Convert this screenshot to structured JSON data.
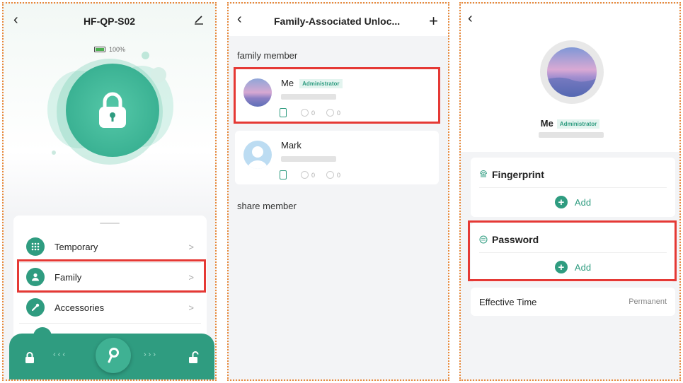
{
  "device": {
    "title": "HF-QP-S02",
    "battery_label": "100%",
    "battery_level": 1.0
  },
  "menu": [
    {
      "label": "Temporary",
      "icon": "keypad-icon"
    },
    {
      "label": "Family",
      "icon": "person-icon"
    },
    {
      "label": "Accessories",
      "icon": "wrench-icon"
    }
  ],
  "unlock_list": {
    "title": "Family-Associated Unloc...",
    "family_section_label": "family member",
    "share_section_label": "share member",
    "members": [
      {
        "name": "Me",
        "badge": "Administrator",
        "fingerprint_count": "0",
        "password_count": "0"
      },
      {
        "name": "Mark",
        "badge": "",
        "fingerprint_count": "0",
        "password_count": "0"
      }
    ]
  },
  "member_detail": {
    "name": "Me",
    "badge": "Administrator",
    "fingerprint_title": "Fingerprint",
    "password_title": "Password",
    "add_label": "Add",
    "effective_time_label": "Effective Time",
    "effective_time_value": "Permanent"
  },
  "colors": {
    "accent": "#2f9c80",
    "highlight": "#e53935",
    "frame": "#e8893a"
  }
}
